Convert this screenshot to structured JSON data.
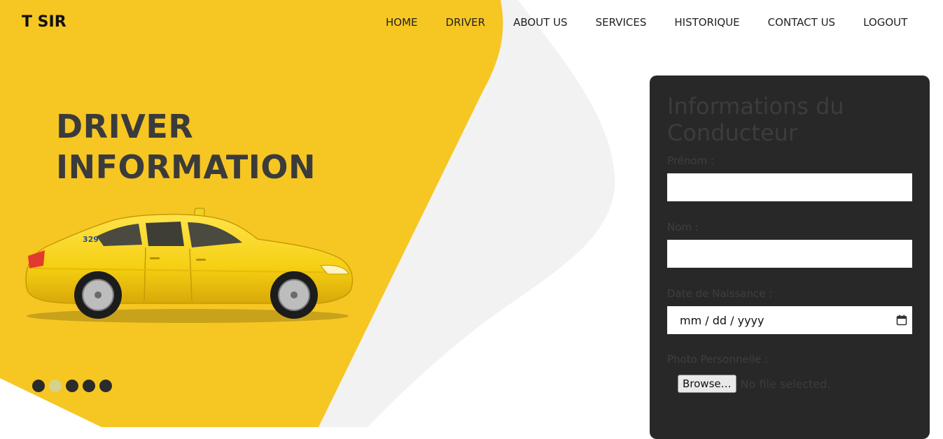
{
  "brand": "T SIR",
  "nav": {
    "items": [
      {
        "label": "HOME"
      },
      {
        "label": "DRIVER"
      },
      {
        "label": "ABOUT US"
      },
      {
        "label": "SERVICES"
      },
      {
        "label": "HISTORIQUE"
      },
      {
        "label": "CONTACT US"
      },
      {
        "label": "LOGOUT"
      }
    ]
  },
  "hero": {
    "title_line1": "DRIVER",
    "title_line2": "INFORMATION",
    "car_number": "329"
  },
  "slider": {
    "count": 5,
    "active_index": 1
  },
  "form": {
    "title": "Informations du Conducteur",
    "prenom_label": "Prénom :",
    "prenom_value": "",
    "nom_label": "Nom :",
    "nom_value": "",
    "dob_label": "Date de Naissance :",
    "dob_placeholder": "mm / dd / yyyy",
    "photo_label": "Photo Personnelle :",
    "browse_label": "Browse…",
    "file_status": "No file selected."
  },
  "colors": {
    "accent_yellow": "#f6c623",
    "panel_bg": "#282828",
    "swoosh_gray": "#f2f2f2",
    "active_dot": "#d6d28c"
  },
  "icons": {
    "calendar": "calendar-icon"
  }
}
